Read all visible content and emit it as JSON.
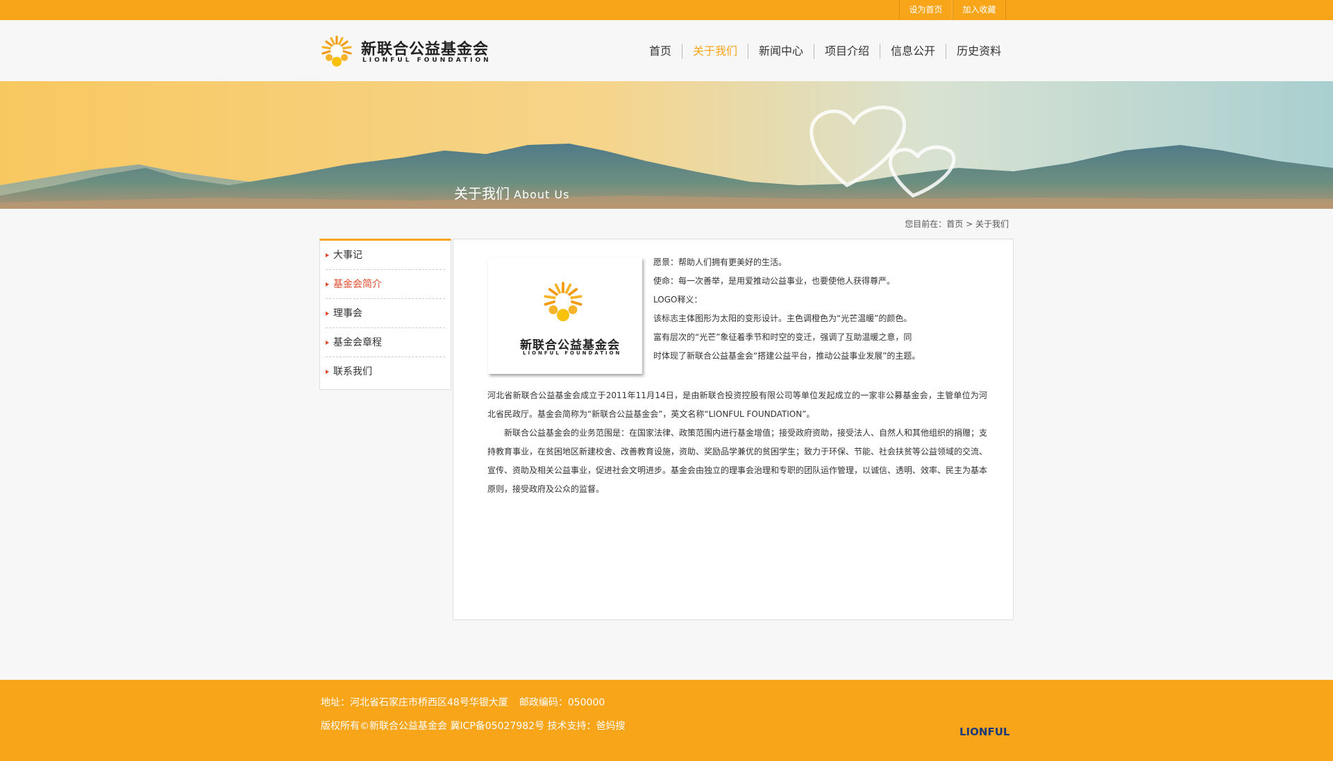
{
  "topbar": {
    "links": [
      "设为首页",
      "加入收藏"
    ]
  },
  "logo": {
    "name_cn": "新联合公益基金会",
    "name_en": "LIONFUL FOUNDATION"
  },
  "nav": {
    "items": [
      "首页",
      "关于我们",
      "新闻中心",
      "项目介绍",
      "信息公开",
      "历史资料"
    ],
    "active": "关于我们"
  },
  "banner": {
    "title_cn": "关于我们",
    "title_en": "About Us"
  },
  "breadcrumb": {
    "prefix": "您目前在：",
    "home": "首页",
    "separator": ">",
    "current": "关于我们"
  },
  "sidebar": {
    "items": [
      "大事记",
      "基金会简介",
      "理事会",
      "基金会章程",
      "联系我们"
    ],
    "active": "基金会简介"
  },
  "content": {
    "intro": [
      "愿景：帮助人们拥有更美好的生活。",
      "使命：每一次善举，是用爱推动公益事业，也要使他人获得尊严。",
      "LOGO释义：",
      "该标志主体图形为太阳的变形设计。主色调橙色为“光芒温暖”的颜色。",
      "富有层次的“光芒”象征着季节和时空的变迁，强调了互助温暖之意，同",
      "时体现了新联合公益基金会“搭建公益平台，推动公益事业发展”的主题。"
    ],
    "paragraph1": "河北省新联合公益基金会成立于2011年11月14日，是由新联合投资控股有限公司等单位发起成立的一家非公募基金会，主管单位为河北省民政厅。基金会简称为“新联合公益基金会”，英文名称“LIONFUL FOUNDATION”。",
    "paragraph2": "新联合公益基金会的业务范围是：在国家法律、政策范围内进行基金增值；接受政府资助，接受法人、自然人和其他组织的捐赠；支持教育事业，在贫困地区新建校舍、改善教育设施，资助、奖励品学兼优的贫困学生；致力于环保、节能、社会扶贫等公益领域的交流、宣传、资助及相关公益事业，促进社会文明进步。基金会由独立的理事会治理和专职的团队运作管理，以诚信、透明、效率、民主为基本原则，接受政府及公众的监督。"
  },
  "footer": {
    "address": "地址：河北省石家庄市桥西区48号华银大厦",
    "postcode": "邮政编码：050000",
    "copyright": "版权所有©新联合公益基金会 冀ICP备05027982号 技术支持：爸妈搜",
    "brand": "LIONFUL"
  },
  "colors": {
    "accent": "#f9a51a",
    "active_side": "#e34a2a",
    "brand_blue": "#1d3a7a"
  }
}
